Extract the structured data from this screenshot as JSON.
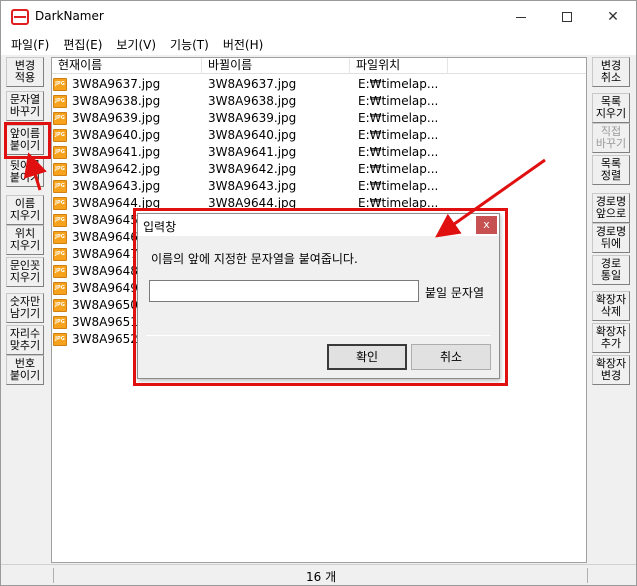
{
  "window": {
    "title": "DarkNamer"
  },
  "menu": [
    "파일(F)",
    "편집(E)",
    "보기(V)",
    "기능(T)",
    "버전(H)"
  ],
  "sidebar_left": [
    "변경\n적용",
    "문자열\n바꾸기",
    "앞이름\n붙이기",
    "뒷이름\n붙이기",
    "이름\n지우기",
    "위치\n지우기",
    "문인꼿\n지우기",
    "숫자만\n남기기",
    "자리수\n맞추기",
    "번호\n붙이기"
  ],
  "sidebar_right": [
    "변경\n취소",
    "목록\n지우기",
    "직접\n바꾸기",
    "목록\n정렬",
    "경로명\n앞으로",
    "경로명\n뒤에",
    "경로\n통일",
    "확장자\n삭제",
    "확장자\n추가",
    "확장자\n변경"
  ],
  "columns": [
    "현재이름",
    "바뀔이름",
    "파일위치"
  ],
  "file_icon_label": "JPG",
  "rows": [
    {
      "current": "3W8A9637.jpg",
      "new": "3W8A9637.jpg",
      "path": "E:₩timelap..."
    },
    {
      "current": "3W8A9638.jpg",
      "new": "3W8A9638.jpg",
      "path": "E:₩timelap..."
    },
    {
      "current": "3W8A9639.jpg",
      "new": "3W8A9639.jpg",
      "path": "E:₩timelap..."
    },
    {
      "current": "3W8A9640.jpg",
      "new": "3W8A9640.jpg",
      "path": "E:₩timelap..."
    },
    {
      "current": "3W8A9641.jpg",
      "new": "3W8A9641.jpg",
      "path": "E:₩timelap..."
    },
    {
      "current": "3W8A9642.jpg",
      "new": "3W8A9642.jpg",
      "path": "E:₩timelap..."
    },
    {
      "current": "3W8A9643.jpg",
      "new": "3W8A9643.jpg",
      "path": "E:₩timelap..."
    },
    {
      "current": "3W8A9644.jpg",
      "new": "3W8A9644.jpg",
      "path": "E:₩timelap..."
    },
    {
      "current": "3W8A9645.j",
      "new": "",
      "path": ""
    },
    {
      "current": "3W8A9646.j",
      "new": "",
      "path": ""
    },
    {
      "current": "3W8A9647.j",
      "new": "",
      "path": ""
    },
    {
      "current": "3W8A9648.j",
      "new": "",
      "path": ""
    },
    {
      "current": "3W8A9649.j",
      "new": "",
      "path": ""
    },
    {
      "current": "3W8A9650.j",
      "new": "",
      "path": ""
    },
    {
      "current": "3W8A9651.j",
      "new": "",
      "path": ""
    },
    {
      "current": "3W8A9652.j",
      "new": "",
      "path": ""
    }
  ],
  "status": {
    "count": "16 개"
  },
  "dialog": {
    "title": "입력창",
    "close": "x",
    "message": "이름의 앞에 지정한 문자열을 붙여줍니다.",
    "input_value": "",
    "input_label": "붙일 문자열",
    "ok": "확인",
    "cancel": "취소"
  },
  "colors": {
    "annotation": "#e01010",
    "accent": "#e02020"
  }
}
